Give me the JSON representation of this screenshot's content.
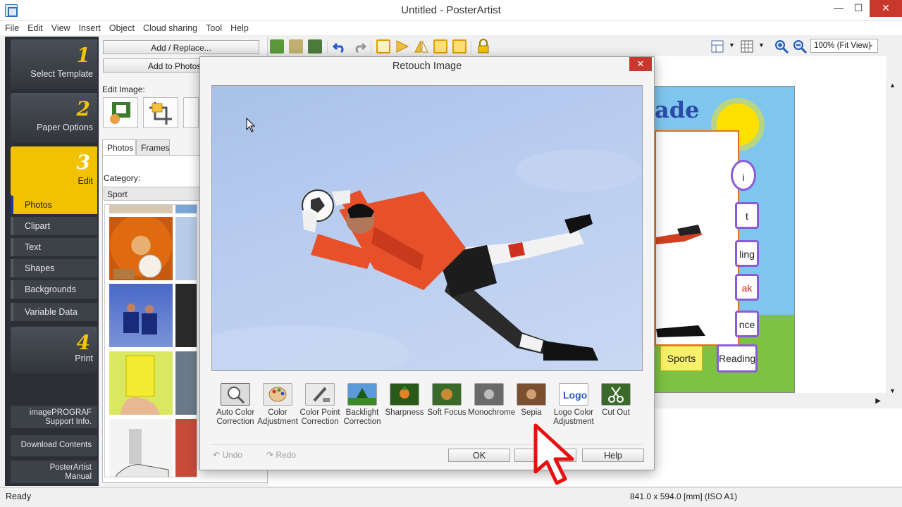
{
  "window": {
    "title": "Untitled - PosterArtist",
    "minimize": "—",
    "maximize": "☐",
    "close": "✕"
  },
  "menu": [
    "File",
    "Edit",
    "View",
    "Insert",
    "Object",
    "Cloud sharing",
    "Tool",
    "Help"
  ],
  "steps": [
    {
      "num": "1",
      "label": "Select Template"
    },
    {
      "num": "2",
      "label": "Paper Options"
    },
    {
      "num": "3",
      "label": "Edit"
    },
    {
      "num": "4",
      "label": "Print"
    }
  ],
  "edit_subitems": [
    "Photos",
    "Clipart",
    "Text",
    "Shapes",
    "Backgrounds",
    "Variable Data"
  ],
  "bottom_buttons": {
    "support": "imagePROGRAF Support Info.",
    "support_line1": "imagePROGRAF",
    "support_line2": "Support Info.",
    "download": "Download Contents",
    "manual_line1": "PosterArtist",
    "manual_line2": "Manual"
  },
  "editpanel": {
    "add_replace": "Add / Replace...",
    "add_to_photos": "Add to Photos / C",
    "edit_image_label": "Edit Image:",
    "tabs": [
      "Photos",
      "Frames"
    ],
    "category_label": "Category:",
    "category_value": "Sport"
  },
  "zoom": {
    "value": "100% (Fit View)"
  },
  "poster": {
    "title_fragment": "ade",
    "label_i": "i",
    "label_t": "t",
    "label_ling": "ling",
    "label_ak": "ak",
    "label_nce": "nce",
    "sports": "Sports",
    "reading": "Reading",
    "accent_orange": "#e07020",
    "accent_purple": "#8a5bd6"
  },
  "dialog": {
    "title": "Retouch Image",
    "close": "✕",
    "tools": [
      {
        "line1": "Auto Color",
        "line2": "Correction"
      },
      {
        "line1": "Color",
        "line2": "Adjustment"
      },
      {
        "line1": "Color Point",
        "line2": "Correction"
      },
      {
        "line1": "Backlight",
        "line2": "Correction"
      },
      {
        "line1": "Sharpness",
        "line2": ""
      },
      {
        "line1": "Soft Focus",
        "line2": ""
      },
      {
        "line1": "Monochrome",
        "line2": ""
      },
      {
        "line1": "Sepia",
        "line2": ""
      },
      {
        "line1": "Logo Color",
        "line2": "Adjustment"
      },
      {
        "line1": "Cut Out",
        "line2": ""
      }
    ],
    "undo": "Undo",
    "redo": "Redo",
    "ok": "OK",
    "cancel": "C",
    "help": "Help"
  },
  "status": {
    "left": "Ready",
    "right": "841.0 x 594.0 [mm] (ISO A1)"
  },
  "icons": [
    "app-icon",
    "undo-icon",
    "redo-icon",
    "lock-icon",
    "zoom-in-icon",
    "zoom-out-icon",
    "grid-icon",
    "layout-icon",
    "mouse-pointer-icon",
    "hand-cursor-icon"
  ]
}
